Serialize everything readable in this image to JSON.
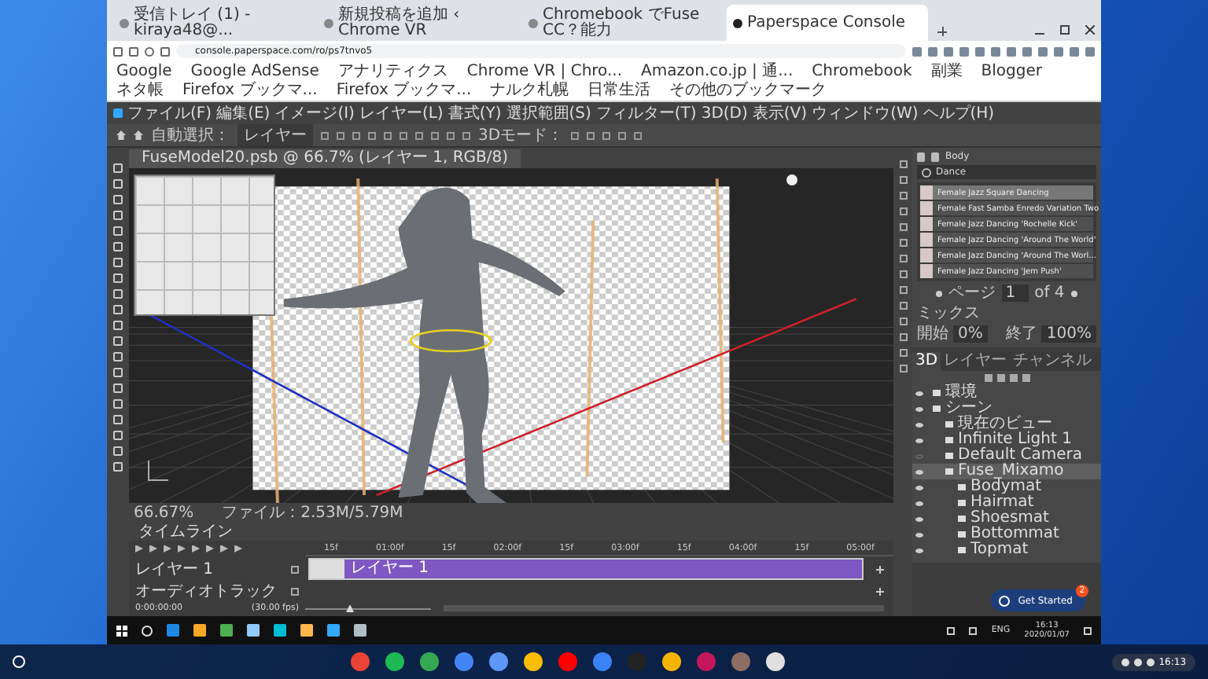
{
  "browser": {
    "tabs": [
      {
        "title": "受信トレイ (1) - kiraya48@...",
        "selected": false
      },
      {
        "title": "新規投稿を追加 ‹ Chrome VR",
        "selected": false
      },
      {
        "title": "Chromebook でFuse CC？能力",
        "selected": false
      },
      {
        "title": "Paperspace Console",
        "selected": true
      }
    ],
    "address": "console.paperspace.com/ro/ps7tnvo5",
    "bookmarks": [
      "Google",
      "Google AdSense",
      "アナリティクス",
      "Chrome VR | Chro...",
      "Amazon.co.jp | 通...",
      "Chromebook",
      "副業",
      "Blogger",
      "ネタ帳",
      "Firefox ブックマ...",
      "Firefox ブックマ...",
      "ナルク札幌",
      "日常生活",
      "その他のブックマーク"
    ]
  },
  "photoshop": {
    "menu": [
      "ファイル(F)",
      "編集(E)",
      "イメージ(I)",
      "レイヤー(L)",
      "書式(Y)",
      "選択範囲(S)",
      "フィルター(T)",
      "3D(D)",
      "表示(V)",
      "ウィンドウ(W)",
      "ヘルプ(H)"
    ],
    "options": {
      "auto_select_label": "自動選択：",
      "auto_select_value": "レイヤー",
      "mode_label": "3Dモード："
    },
    "document_tab": "FuseModel20.psb @ 66.7% (レイヤー 1, RGB/8)",
    "status": {
      "zoom": "66.67%",
      "file": "ファイル：2.53M/5.79M"
    },
    "fuse_panel": {
      "title": "Body",
      "search": "Dance",
      "items": [
        {
          "label": "Female Jazz Square Dancing",
          "selected": true
        },
        {
          "label": "Female Fast Samba Enredo Variation Two",
          "selected": false
        },
        {
          "label": "Female Jazz Dancing 'Rochelle Kick'",
          "selected": false
        },
        {
          "label": "Female Jazz Dancing 'Around The World'",
          "selected": false
        },
        {
          "label": "Female Jazz Dancing 'Around The Worl...",
          "selected": false
        },
        {
          "label": "Female Jazz Dancing 'Jem Push'",
          "selected": false
        }
      ],
      "page_label": "ページ",
      "page": "1",
      "page_total": "of 4",
      "section": "ミックス",
      "left_label": "開始",
      "left_value": "0%",
      "right_label": "終了",
      "right_value": "100%"
    },
    "layers_panel": {
      "tabs": [
        {
          "label": "3D",
          "selected": true
        },
        {
          "label": "レイヤー",
          "selected": false
        },
        {
          "label": "チャンネル",
          "selected": false
        }
      ],
      "tree": [
        {
          "label": "環境",
          "visible": true,
          "selected": false
        },
        {
          "label": "シーン",
          "visible": true,
          "selected": false,
          "children": [
            {
              "label": "現在のビュー",
              "visible": true,
              "selected": false
            },
            {
              "label": "Infinite Light 1",
              "visible": true,
              "selected": false
            },
            {
              "label": "Default Camera",
              "visible": false,
              "selected": false
            },
            {
              "label": "Fuse_Mixamo",
              "visible": true,
              "selected": true,
              "children": [
                {
                  "label": "Bodymat",
                  "visible": true,
                  "selected": false
                },
                {
                  "label": "Hairmat",
                  "visible": true,
                  "selected": false
                },
                {
                  "label": "Shoesmat",
                  "visible": true,
                  "selected": false
                },
                {
                  "label": "Bottommat",
                  "visible": true,
                  "selected": false
                },
                {
                  "label": "Topmat",
                  "visible": true,
                  "selected": false
                }
              ]
            }
          ]
        }
      ]
    },
    "timeline": {
      "title": "タイムライン",
      "ruler": [
        "15f",
        "01:00f",
        "15f",
        "02:00f",
        "15f",
        "03:00f",
        "15f",
        "04:00f",
        "15f",
        "05:00f"
      ],
      "track": {
        "label": "レイヤー 1",
        "clip": "レイヤー 1"
      },
      "audio": "オーディオトラック",
      "time": "0:00:00:00",
      "fps": "(30.00 fps)",
      "zoom": {
        "level": 0.35
      }
    }
  },
  "taskbar": {
    "lang": "ENG",
    "time": "16:13",
    "date": "2020/01/07"
  },
  "chat": {
    "label": "Get Started",
    "badge": "2"
  },
  "shelf": {
    "time": "16:13"
  }
}
